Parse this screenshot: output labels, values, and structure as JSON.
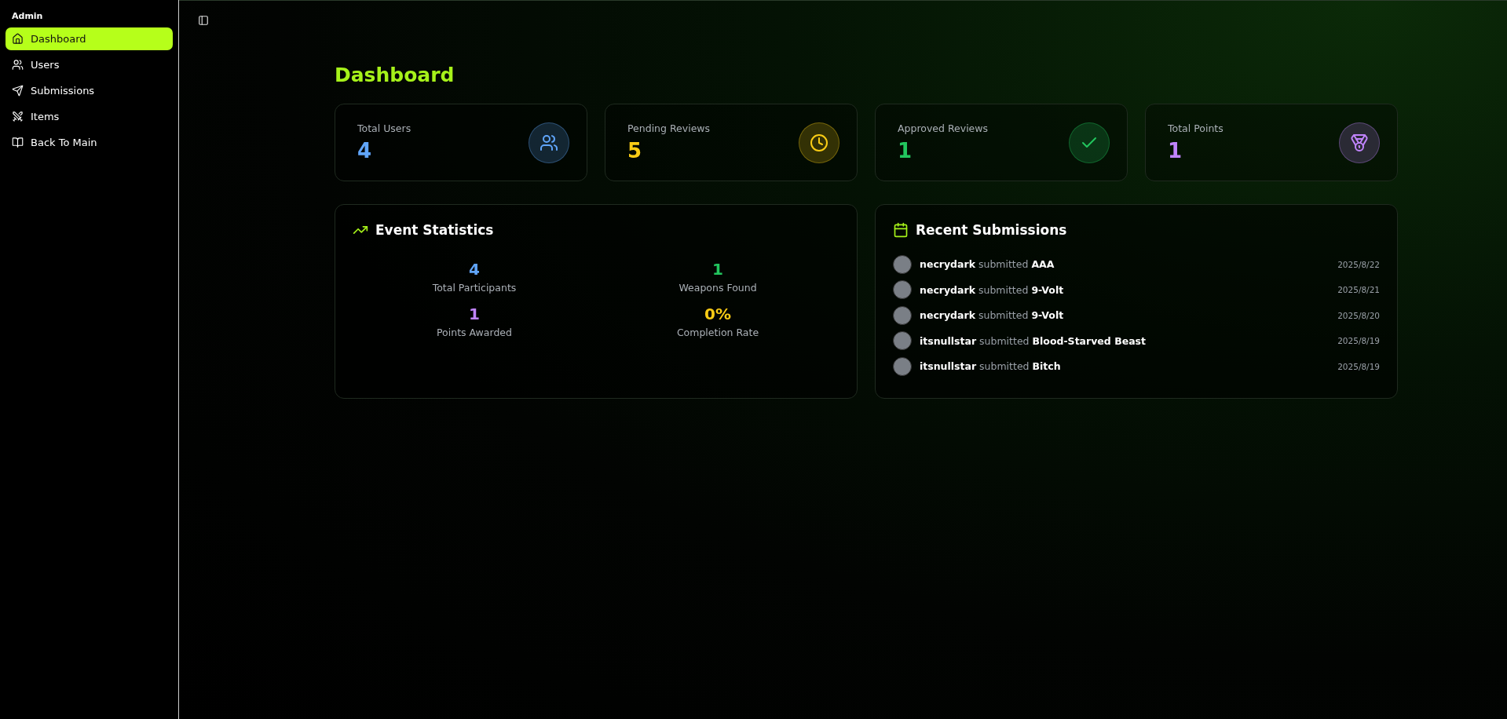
{
  "sidebar": {
    "title": "Admin",
    "items": [
      {
        "label": "Dashboard",
        "selected": true
      },
      {
        "label": "Users",
        "selected": false
      },
      {
        "label": "Submissions",
        "selected": false
      },
      {
        "label": "Items",
        "selected": false
      },
      {
        "label": "Back To Main",
        "selected": false
      }
    ]
  },
  "page_title": "Dashboard",
  "stat_cards": [
    {
      "label": "Total Users",
      "value": "4",
      "color": "#60a5fa"
    },
    {
      "label": "Pending Reviews",
      "value": "5",
      "color": "#facc15"
    },
    {
      "label": "Approved Reviews",
      "value": "1",
      "color": "#22c55e"
    },
    {
      "label": "Total Points",
      "value": "1",
      "color": "#c084fc"
    }
  ],
  "event_statistics": {
    "title": "Event Statistics",
    "stats": [
      {
        "value": "4",
        "label": "Total Participants",
        "color": "#60a5fa"
      },
      {
        "value": "1",
        "label": "Weapons Found",
        "color": "#22c55e"
      },
      {
        "value": "1",
        "label": "Points Awarded",
        "color": "#c084fc"
      },
      {
        "value": "0%",
        "label": "Completion Rate",
        "color": "#facc15"
      }
    ]
  },
  "recent_submissions": {
    "title": "Recent Submissions",
    "rows": [
      {
        "text": "**necrydark** submitted **AAA**",
        "date": "2025/8/22"
      },
      {
        "text": "**necrydark** submitted **9-Volt**",
        "date": "2025/8/21"
      },
      {
        "text": "**necrydark** submitted **9-Volt**",
        "date": "2025/8/20"
      },
      {
        "text": "**itsnullstar** submitted **Blood-Starved Beast**",
        "date": "2025/8/19"
      },
      {
        "text": "**itsnullstar** submitted **Bitch**",
        "date": "2025/8/19"
      }
    ]
  }
}
